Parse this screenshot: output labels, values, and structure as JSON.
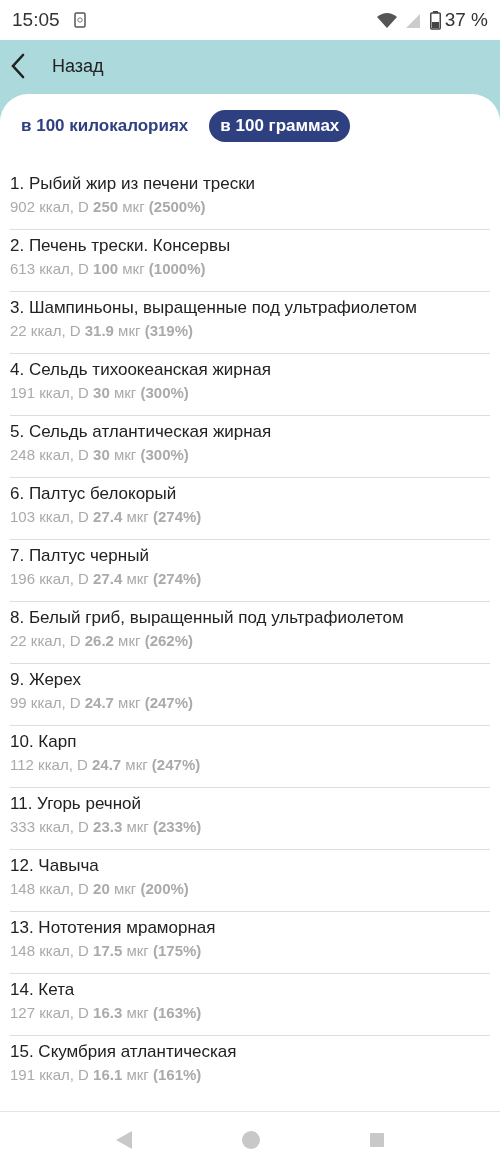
{
  "status_bar": {
    "time": "15:05",
    "battery": "37 %"
  },
  "header": {
    "back_label": "Назад"
  },
  "tabs": [
    {
      "label": "в 100 килокалориях",
      "selected": false
    },
    {
      "label": "в 100 граммах",
      "selected": true
    }
  ],
  "items": [
    {
      "title": "1. Рыбий жир из печени трески",
      "detail": "902 ккал, D **250** мкг **(2500%)**"
    },
    {
      "title": "2. Печень трески. Консервы",
      "detail": "613 ккал, D **100** мкг **(1000%)**"
    },
    {
      "title": "3. Шампиньоны, выращенные под ультрафиолетом",
      "detail": "22 ккал, D **31.9** мкг **(319%)**"
    },
    {
      "title": "4. Сельдь тихоокеанская жирная",
      "detail": "191 ккал, D **30** мкг **(300%)**"
    },
    {
      "title": "5. Сельдь атлантическая жирная",
      "detail": "248 ккал, D **30** мкг **(300%)**"
    },
    {
      "title": "6. Палтус белокорый",
      "detail": "103 ккал, D **27.4** мкг **(274%)**"
    },
    {
      "title": "7. Палтус черный",
      "detail": "196 ккал, D **27.4** мкг **(274%)**"
    },
    {
      "title": "8. Белый гриб, выращенный под ультрафиолетом",
      "detail": "22 ккал, D **26.2** мкг **(262%)**"
    },
    {
      "title": "9. Жерех",
      "detail": "99 ккал, D **24.7** мкг **(247%)**"
    },
    {
      "title": "10. Карп",
      "detail": "112 ккал, D **24.7** мкг **(247%)**"
    },
    {
      "title": "11. Угорь речной",
      "detail": "333 ккал, D **23.3** мкг **(233%)**"
    },
    {
      "title": "12. Чавыча",
      "detail": "148 ккал, D **20** мкг **(200%)**"
    },
    {
      "title": "13. Нототения мраморная",
      "detail": "148 ккал, D **17.5** мкг **(175%)**"
    },
    {
      "title": "14. Кета",
      "detail": "127 ккал, D **16.3** мкг **(163%)**"
    },
    {
      "title": "15. Скумбрия атлантическая",
      "detail": "191 ккал, D **16.1** мкг **(161%)**"
    }
  ]
}
